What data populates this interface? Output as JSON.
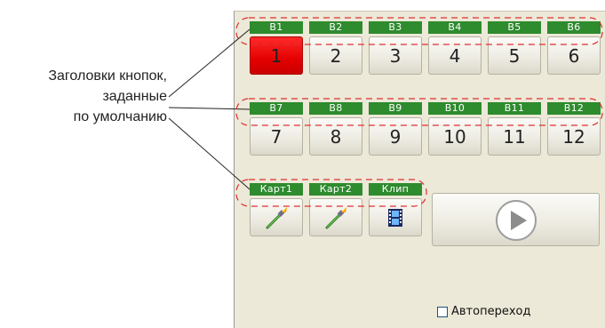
{
  "callout": {
    "line1": "Заголовки кнопок,",
    "line2": "заданные",
    "line3": "по умолчанию"
  },
  "row1": [
    {
      "caption": "B1",
      "label": "1",
      "state": "active"
    },
    {
      "caption": "B2",
      "label": "2"
    },
    {
      "caption": "B3",
      "label": "3"
    },
    {
      "caption": "B4",
      "label": "4"
    },
    {
      "caption": "B5",
      "label": "5"
    },
    {
      "caption": "B6",
      "label": "6"
    }
  ],
  "row2": [
    {
      "caption": "B7",
      "label": "7"
    },
    {
      "caption": "B8",
      "label": "8"
    },
    {
      "caption": "B9",
      "label": "9"
    },
    {
      "caption": "B10",
      "label": "10"
    },
    {
      "caption": "B11",
      "label": "11"
    },
    {
      "caption": "B12",
      "label": "12"
    }
  ],
  "row3": [
    {
      "caption": "Карт1",
      "icon": "brush-icon"
    },
    {
      "caption": "Карт2",
      "icon": "brush-icon"
    },
    {
      "caption": "Клип",
      "icon": "film-icon"
    }
  ],
  "play": {
    "icon": "play-icon"
  },
  "autotransition": {
    "label": "Автопереход",
    "checked": false
  },
  "colors": {
    "caption_bg": "#2e8b2e",
    "active": "#ff0000",
    "panel": "#ece9d8",
    "dash": "#e03030"
  }
}
